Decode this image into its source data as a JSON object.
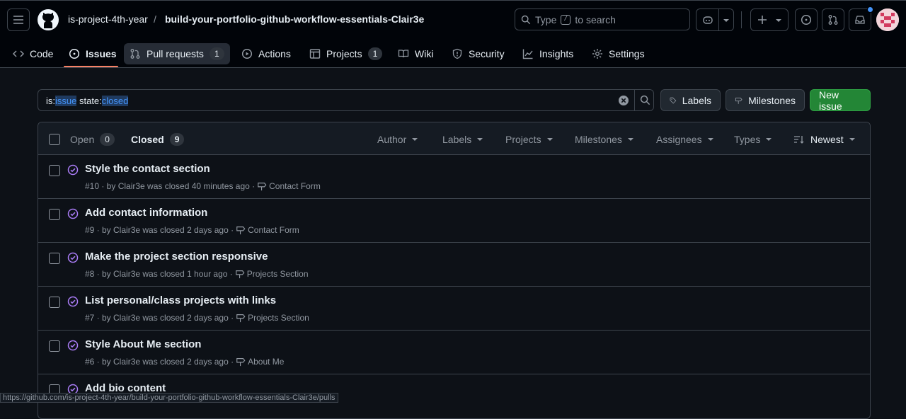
{
  "header": {
    "owner": "is-project-4th-year",
    "separator": "/",
    "repo": "build-your-portfolio-github-workflow-essentials-Clair3e",
    "search_prefix": "Type",
    "search_key": "/",
    "search_suffix": "to search"
  },
  "nav": {
    "tabs": [
      {
        "label": "Code",
        "icon": "code-icon"
      },
      {
        "label": "Issues",
        "icon": "issue-opened-icon"
      },
      {
        "label": "Pull requests",
        "icon": "git-pull-request-icon",
        "count": "1"
      },
      {
        "label": "Actions",
        "icon": "play-icon"
      },
      {
        "label": "Projects",
        "icon": "table-icon",
        "count": "1"
      },
      {
        "label": "Wiki",
        "icon": "book-icon"
      },
      {
        "label": "Security",
        "icon": "shield-icon"
      },
      {
        "label": "Insights",
        "icon": "graph-icon"
      },
      {
        "label": "Settings",
        "icon": "gear-icon"
      }
    ]
  },
  "query": {
    "is_key": "is:",
    "is_val": "issue",
    "state_key": " state:",
    "state_val": "closed"
  },
  "buttons": {
    "labels": "Labels",
    "milestones": "Milestones",
    "new_issue": "New issue"
  },
  "list_header": {
    "open_label": "Open",
    "open_count": "0",
    "closed_label": "Closed",
    "closed_count": "9",
    "filters": [
      "Author",
      "Labels",
      "Projects",
      "Milestones",
      "Assignees",
      "Types"
    ],
    "sort": "Newest"
  },
  "issues": [
    {
      "title": "Style the contact section",
      "meta": "#10 · by Clair3e was closed 40 minutes ago ·",
      "milestone": "Contact Form"
    },
    {
      "title": "Add contact information",
      "meta": "#9 · by Clair3e was closed 2 days ago ·",
      "milestone": "Contact Form"
    },
    {
      "title": "Make the project section responsive",
      "meta": "#8 · by Clair3e was closed 1 hour ago ·",
      "milestone": "Projects Section"
    },
    {
      "title": "List personal/class projects with links",
      "meta": "#7 · by Clair3e was closed 2 days ago ·",
      "milestone": "Projects Section"
    },
    {
      "title": "Style About Me section",
      "meta": "#6 · by Clair3e was closed 2 days ago ·",
      "milestone": "About Me"
    },
    {
      "title": "Add bio content",
      "meta": "",
      "milestone": ""
    }
  ],
  "status_url": "https://github.com/is-project-4th-year/build-your-portfolio-github-workflow-essentials-Clair3e/pulls",
  "colors": {
    "accent": "#f78166",
    "closed": "#ab7df8",
    "green": "#238636",
    "link": "#4493f8"
  }
}
